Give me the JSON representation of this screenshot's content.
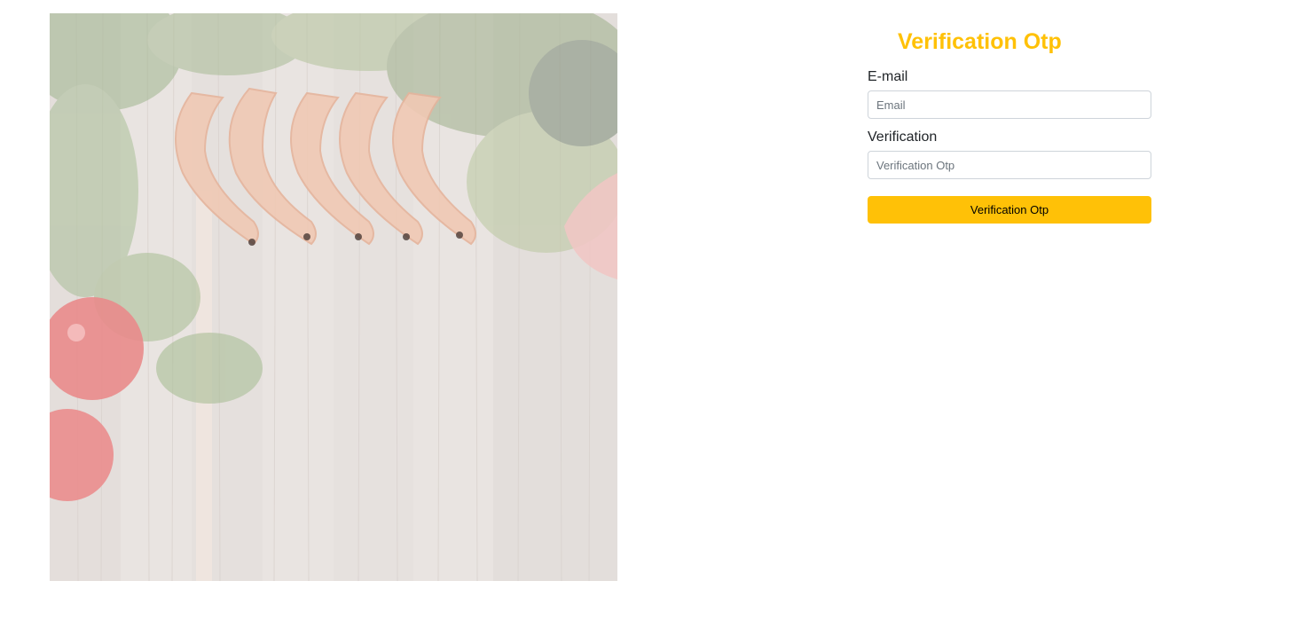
{
  "form": {
    "title": "Verification Otp",
    "email_label": "E-mail",
    "email_placeholder": "Email",
    "email_value": "",
    "verification_label": "Verification",
    "verification_placeholder": "Verification Otp",
    "verification_value": "",
    "submit_label": "Verification Otp"
  },
  "colors": {
    "accent": "#ffc107",
    "input_border": "#ced4da",
    "label_text": "#212529"
  },
  "hero_image": {
    "subject": "faded food photo: shrimp, lettuce, parsley, tomatoes and fish on wooden boards"
  }
}
